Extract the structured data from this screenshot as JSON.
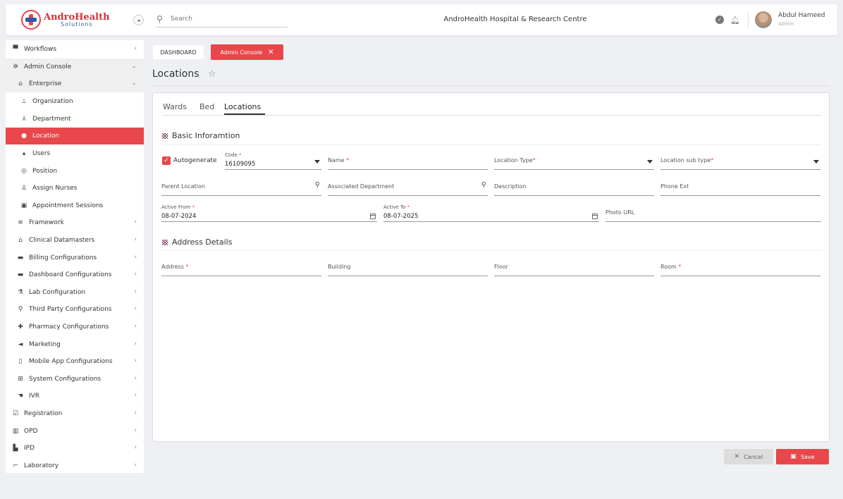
{
  "header": {
    "logo_line1": "AndroHealth",
    "logo_line2": "Solutions",
    "search_placeholder": "Search",
    "hospital_name": "AndroHealth Hospital & Research Centre",
    "user_name": "Abdul Hameed",
    "user_role": "Admin"
  },
  "sidebar": {
    "items": [
      {
        "label": "Workflows",
        "icon": "monitor-icon"
      },
      {
        "label": "Admin Console",
        "icon": "gear-icon"
      },
      {
        "label": "Enterprise",
        "icon": "bank-icon"
      },
      {
        "label": "Organization",
        "icon": "org-chart-icon"
      },
      {
        "label": "Department",
        "icon": "hierarchy-icon"
      },
      {
        "label": "Location",
        "icon": "map-pin-icon"
      },
      {
        "label": "Users",
        "icon": "user-icon"
      },
      {
        "label": "Position",
        "icon": "compass-icon"
      },
      {
        "label": "Assign Nurses",
        "icon": "nurse-icon"
      },
      {
        "label": "Appointment Sessions",
        "icon": "calendar-icon"
      },
      {
        "label": "Framework",
        "icon": "layers-icon"
      },
      {
        "label": "Clinical Datamasters",
        "icon": "home-icon"
      },
      {
        "label": "Billing Configurations",
        "icon": "card-icon"
      },
      {
        "label": "Dashboard Configurations",
        "icon": "dashboard-icon"
      },
      {
        "label": "Lab Configuration",
        "icon": "flask-icon"
      },
      {
        "label": "Third Party Configurations",
        "icon": "plug-icon"
      },
      {
        "label": "Pharmacy Configurations",
        "icon": "medkit-icon"
      },
      {
        "label": "Marketing",
        "icon": "megaphone-icon"
      },
      {
        "label": "Mobile App Configurations",
        "icon": "mobile-icon"
      },
      {
        "label": "System Configurations",
        "icon": "system-icon"
      },
      {
        "label": "IVR",
        "icon": "hand-icon"
      },
      {
        "label": "Registration",
        "icon": "clipboard-icon"
      },
      {
        "label": "OPD",
        "icon": "building-icon"
      },
      {
        "label": "IPD",
        "icon": "bed-icon"
      },
      {
        "label": "Laboratory",
        "icon": "microscope-icon"
      }
    ]
  },
  "breadcrumbs": {
    "dashboard": "DASHBOARD",
    "admin_console": "Admin Console"
  },
  "page": {
    "title": "Locations"
  },
  "tabs": [
    "Wards",
    "Bed",
    "Locations"
  ],
  "sections": {
    "basic": "Basic Inforamtion",
    "address": "Address Details"
  },
  "form": {
    "autogenerate_label": "Autogenerate",
    "code_label": "Code",
    "code_value": "16109095",
    "name_label": "Name",
    "location_type_label": "Location Type",
    "location_sub_type_label": "Location sub type",
    "parent_location_label": "Parent Location",
    "associated_department_label": "Associated Department",
    "description_label": "Description",
    "phone_ext_label": "Phone Ext",
    "active_from_label": "Active From",
    "active_from_value": "08-07-2024",
    "active_to_label": "Active To",
    "active_to_value": "08-07-2025",
    "photo_url_label": "Photo URL",
    "address_label": "Address",
    "building_label": "Building",
    "floor_label": "Floor",
    "room_label": "Room",
    "required_mark": "*"
  },
  "buttons": {
    "cancel": "Cancel",
    "save": "Save"
  },
  "colors": {
    "accent": "#e8474b",
    "brand_blue": "#2d5aa8"
  }
}
